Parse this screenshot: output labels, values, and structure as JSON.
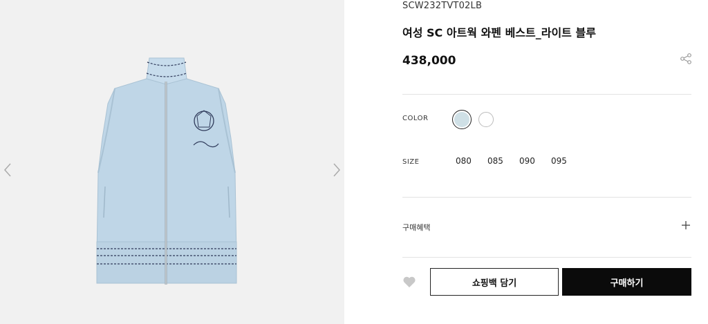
{
  "product": {
    "sku": "SCW232TVT02LB",
    "name": "여성 SC 아트웍 와펜 베스트_라이트 블루",
    "price": "438,000",
    "image_alt": "light blue zip-up vest"
  },
  "options": {
    "color_label": "COLOR",
    "colors": [
      "light-blue",
      "white"
    ],
    "selected_color": "light-blue",
    "size_label": "SIZE",
    "sizes": [
      "080",
      "085",
      "090",
      "095"
    ]
  },
  "benefits": {
    "label": "구매혜택"
  },
  "actions": {
    "cart_label": "쇼핑백 담기",
    "buy_label": "구매하기"
  },
  "icons": {
    "prev": "chevron-left-icon",
    "next": "chevron-right-icon",
    "share": "share-icon",
    "expand": "plus-icon",
    "wishlist": "heart-icon"
  },
  "colors": {
    "gallery_bg": "#f1f1f1",
    "swatch_light_blue": "#cfe0e6",
    "buy_button_bg": "#0b0b0b"
  }
}
